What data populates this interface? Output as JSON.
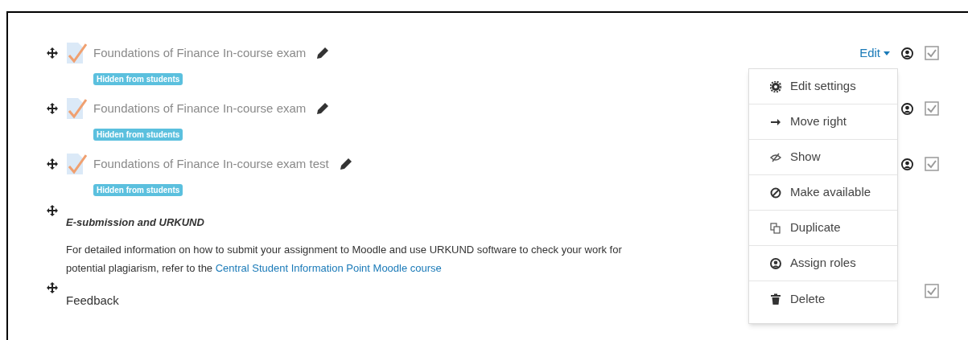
{
  "activities": [
    {
      "name": "Foundations of Finance In-course exam",
      "badge": "Hidden from students",
      "edit_label": "Edit",
      "completion_checked": true
    },
    {
      "name": "Foundations of Finance In-course exam",
      "badge": "Hidden from students",
      "completion_checked": true
    },
    {
      "name": "Foundations of Finance In-course exam test",
      "badge": "Hidden from students",
      "completion_checked": true
    }
  ],
  "label": {
    "title": "E-submission and URKUND",
    "text_line_1": "For detailed information on how to submit your assignment to Moodle and use URKUND software to check your work for",
    "text_line_2": "potential plagiarism, refer to the ",
    "link": "Central Student Information Point Moodle course"
  },
  "feedback": {
    "title": "Feedback",
    "completion_checked": true
  },
  "menu": {
    "open": true,
    "items": [
      {
        "label": "Edit settings",
        "kind": "gear"
      },
      {
        "label": "Move right",
        "kind": "arrow"
      },
      {
        "label": "Show",
        "kind": "eye"
      },
      {
        "label": "Make available",
        "kind": "ban"
      },
      {
        "label": "Duplicate",
        "kind": "copy"
      },
      {
        "label": "Assign roles",
        "kind": "user"
      },
      {
        "label": "Delete",
        "kind": "trash"
      }
    ]
  }
}
